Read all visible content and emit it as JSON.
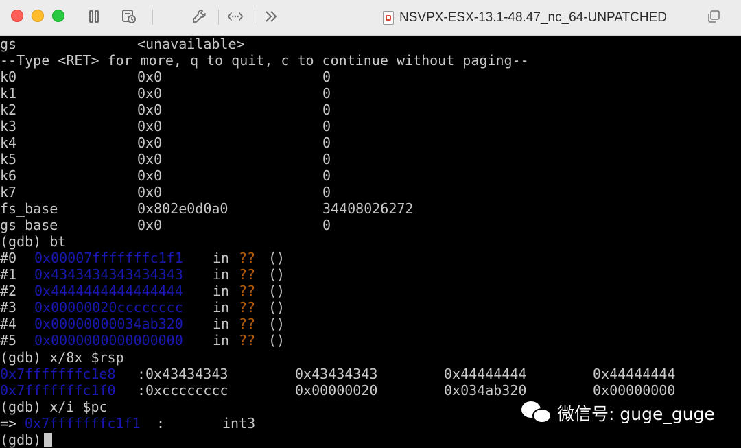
{
  "window": {
    "title": "NSVPX-ESX-13.1-48.47_nc_64-UNPATCHED"
  },
  "toolbar": {
    "icons": [
      "pause-icon",
      "snapshot-icon",
      "wrench-icon",
      "network-icon",
      "forward-icon",
      "copy-window-icon"
    ]
  },
  "colors": {
    "address": "#1818b0",
    "unknown_symbol": "#b85a00",
    "text": "#c8c8c8",
    "background": "#000000"
  },
  "console": {
    "l0": {
      "a": "gs",
      "b": "<unavailable>"
    },
    "l1": {
      "t": "--Type <RET> for more, q to quit, c to continue without paging--"
    },
    "r0": {
      "n": "k0",
      "h": "0x0",
      "d": "0"
    },
    "r1": {
      "n": "k1",
      "h": "0x0",
      "d": "0"
    },
    "r2": {
      "n": "k2",
      "h": "0x0",
      "d": "0"
    },
    "r3": {
      "n": "k3",
      "h": "0x0",
      "d": "0"
    },
    "r4": {
      "n": "k4",
      "h": "0x0",
      "d": "0"
    },
    "r5": {
      "n": "k5",
      "h": "0x0",
      "d": "0"
    },
    "r6": {
      "n": "k6",
      "h": "0x0",
      "d": "0"
    },
    "r7": {
      "n": "k7",
      "h": "0x0",
      "d": "0"
    },
    "r8": {
      "n": "fs_base",
      "h": "0x802e0d0a0",
      "d": "34408026272"
    },
    "r9": {
      "n": "gs_base",
      "h": "0x0",
      "d": "0"
    },
    "cmd_bt": "(gdb) bt",
    "f0": {
      "n": "#0",
      "addr": "0x00007fffffffc1f1",
      "in": "in",
      "q": "??",
      "p": "()"
    },
    "f1": {
      "n": "#1",
      "addr": "0x4343434343434343",
      "in": "in",
      "q": "??",
      "p": "()"
    },
    "f2": {
      "n": "#2",
      "addr": "0x4444444444444444",
      "in": "in",
      "q": "??",
      "p": "()"
    },
    "f3": {
      "n": "#3",
      "addr": "0x00000020cccccccc",
      "in": "in",
      "q": "??",
      "p": "()"
    },
    "f4": {
      "n": "#4",
      "addr": "0x00000000034ab320",
      "in": "in",
      "q": "??",
      "p": "()"
    },
    "f5": {
      "n": "#5",
      "addr": "0x0000000000000000",
      "in": "in",
      "q": "??",
      "p": "()"
    },
    "cmd_x8": "(gdb) x/8x $rsp",
    "m0": {
      "addr": "0x7fffffffc1e8",
      "colon": ":",
      "v1": "0x43434343",
      "v2": "0x43434343",
      "v3": "0x44444444",
      "v4": "0x44444444"
    },
    "m1": {
      "addr": "0x7fffffffc1f0",
      "colon": ":",
      "v1": "0xcccccccc",
      "v2": "0x00000020",
      "v3": "0x034ab320",
      "v4": "0x00000000"
    },
    "cmd_xi": "(gdb) x/i $pc",
    "pc": {
      "arrow": "=>",
      "addr": "0x7fffffffc1f1",
      "colon": ":",
      "ins": "int3"
    },
    "prompt": "(gdb)"
  },
  "watermark": {
    "text": "微信号: guge_guge"
  }
}
